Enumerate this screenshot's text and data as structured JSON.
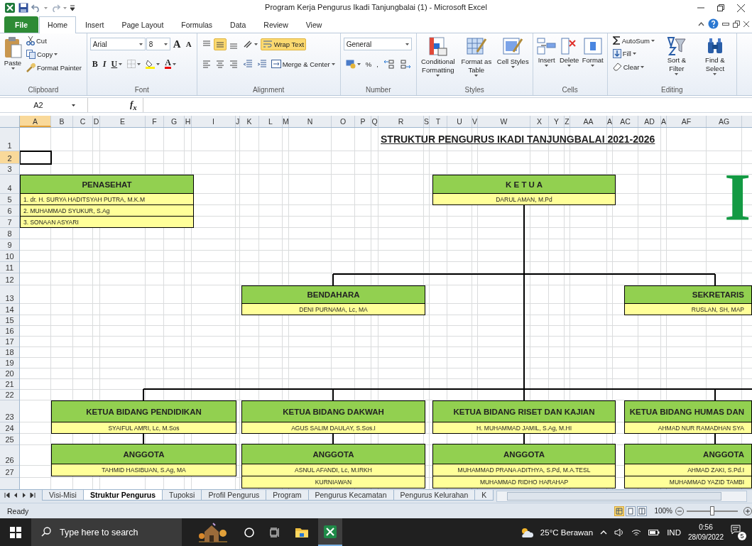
{
  "window": {
    "title": "Program Kerja Pengurus Ikadi Tanjungbalai (1)  -  Microsoft Excel"
  },
  "ribbon_tabs": [
    {
      "label": "File",
      "kind": "file",
      "selected": false
    },
    {
      "label": "Home",
      "kind": "tab",
      "selected": true
    },
    {
      "label": "Insert",
      "kind": "tab",
      "selected": false
    },
    {
      "label": "Page Layout",
      "kind": "tab",
      "selected": false
    },
    {
      "label": "Formulas",
      "kind": "tab",
      "selected": false
    },
    {
      "label": "Data",
      "kind": "tab",
      "selected": false
    },
    {
      "label": "Review",
      "kind": "tab",
      "selected": false
    },
    {
      "label": "View",
      "kind": "tab",
      "selected": false
    }
  ],
  "clipboard": {
    "paste": "Paste",
    "cut": "Cut",
    "copy": "Copy",
    "format_painter": "Format Painter",
    "label": "Clipboard"
  },
  "font": {
    "name": "Arial",
    "size": "8",
    "grow": "A",
    "shrink": "A",
    "bold": "B",
    "italic": "I",
    "underline": "U",
    "color_letter": "A",
    "label": "Font"
  },
  "alignment": {
    "vertical": [
      {
        "selected": false
      },
      {
        "selected": true
      },
      {
        "selected": false
      }
    ],
    "wrap_text": {
      "label": "Wrap Text",
      "selected": true
    },
    "merge": "Merge & Center",
    "label": "Alignment"
  },
  "number": {
    "format": "General",
    "percent": "%",
    "comma": ",",
    "label": "Number"
  },
  "styles": {
    "buttons": [
      "Conditional Formatting",
      "Format as Table",
      "Cell Styles"
    ],
    "label": "Styles"
  },
  "cells": {
    "buttons": [
      "Insert",
      "Delete",
      "Format"
    ],
    "label": "Cells"
  },
  "editing": {
    "autosum": "AutoSum",
    "fill": "Fill",
    "clear": "Clear",
    "sort": "Sort & Filter",
    "find": "Find & Select",
    "label": "Editing"
  },
  "formula_bar": {
    "name_box": "A2",
    "fx": "f$_{x}$"
  },
  "columns": [
    {
      "label": "A",
      "selected": true
    },
    {
      "label": "B",
      "selected": false
    },
    {
      "label": "C",
      "selected": false
    },
    {
      "label": "D",
      "selected": false
    },
    {
      "label": "E",
      "selected": false
    },
    {
      "label": "F",
      "selected": false
    },
    {
      "label": "G",
      "selected": false
    },
    {
      "label": "H",
      "selected": false
    },
    {
      "label": "I",
      "selected": false
    },
    {
      "label": "J",
      "selected": false
    },
    {
      "label": "K",
      "selected": false
    },
    {
      "label": "L",
      "selected": false
    },
    {
      "label": "M",
      "selected": false
    },
    {
      "label": "N",
      "selected": false
    },
    {
      "label": "O",
      "selected": false
    },
    {
      "label": "P",
      "selected": false
    },
    {
      "label": "Q",
      "selected": false
    },
    {
      "label": "R",
      "selected": false
    },
    {
      "label": "S",
      "selected": false
    },
    {
      "label": "T",
      "selected": false
    },
    {
      "label": "U",
      "selected": false
    },
    {
      "label": "V",
      "selected": false
    },
    {
      "label": "W",
      "selected": false
    },
    {
      "label": "X",
      "selected": false
    },
    {
      "label": "Y",
      "selected": false
    },
    {
      "label": "Z",
      "selected": false
    },
    {
      "label": "AA",
      "selected": false
    },
    {
      "label": "A",
      "selected": false
    },
    {
      "label": "AC",
      "selected": false
    },
    {
      "label": "AD",
      "selected": false
    },
    {
      "label": "A",
      "selected": false
    },
    {
      "label": "AF",
      "selected": false
    },
    {
      "label": "AG",
      "selected": false
    }
  ],
  "rows": [
    {
      "label": "1",
      "selected": false
    },
    {
      "label": "2",
      "selected": true
    },
    {
      "label": "3",
      "selected": false
    },
    {
      "label": "4",
      "selected": false
    },
    {
      "label": "5",
      "selected": false
    },
    {
      "label": "6",
      "selected": false
    },
    {
      "label": "7",
      "selected": false
    },
    {
      "label": "8",
      "selected": false
    },
    {
      "label": "9",
      "selected": false
    },
    {
      "label": "10",
      "selected": false
    },
    {
      "label": "11",
      "selected": false
    },
    {
      "label": "12",
      "selected": false
    },
    {
      "label": "13",
      "selected": false
    },
    {
      "label": "14",
      "selected": false
    },
    {
      "label": "15",
      "selected": false
    },
    {
      "label": "16",
      "selected": false
    },
    {
      "label": "17",
      "selected": false
    },
    {
      "label": "18",
      "selected": false
    },
    {
      "label": "19",
      "selected": false
    },
    {
      "label": "20",
      "selected": false
    },
    {
      "label": "21",
      "selected": false
    },
    {
      "label": "22",
      "selected": false
    },
    {
      "label": "23",
      "selected": false
    },
    {
      "label": "24",
      "selected": false
    },
    {
      "label": "25",
      "selected": false
    },
    {
      "label": "26",
      "selected": false
    },
    {
      "label": "27",
      "selected": false
    }
  ],
  "sheet_title": "STRUKTUR PENGURUS IKADI TANJUNGBALAI 2021-2026",
  "logo_text": "I",
  "org_chart": {
    "boxes": [
      {
        "title": "PENASEHAT",
        "members": [
          "1. dr. H. SURYA HADITSYAH PUTRA, M.K.M",
          "2. MUHAMMAD SYUKUR, S.Ag",
          "3. SONAAN ASYARI"
        ]
      },
      {
        "title": "K E T U A",
        "members": [
          "DARUL AMAN, M.Pd"
        ]
      },
      {
        "title": "BENDAHARA",
        "members": [
          "DENI PURNAMA, Lc, MA"
        ]
      },
      {
        "title": "SEKRETARIS",
        "members": [
          "RUSLAN, SH, MAP"
        ]
      },
      {
        "title": "KETUA BIDANG PENDIDIKAN",
        "members": [
          "SYAIFUL AMRI, Lc, M.Sos"
        ]
      },
      {
        "title": "KETUA BIDANG DAKWAH",
        "members": [
          "AGUS SALIM DAULAY, S.Sos.I"
        ]
      },
      {
        "title": "KETUA BIDANG RISET DAN KAJIAN",
        "members": [
          "H. MUHAMMAD JAMIL, S.Ag, M.HI"
        ]
      },
      {
        "title": "KETUA BIDANG HUMAS DAN",
        "members": [
          "AHMAD NUR RAMADHAN SYA"
        ]
      },
      {
        "title": "ANGGOTA",
        "members": [
          "TAHMID HASIBUAN, S.Ag, MA"
        ]
      },
      {
        "title": "ANGGOTA",
        "members": [
          "ASNUL AFANDI, Lc, M.IRKH",
          "KURNIAWAN"
        ]
      },
      {
        "title": "ANGGOTA",
        "members": [
          "MUHAMMAD PRANA ADITHYA, S.Pd, M.A.TESL",
          "MUHAMMAD RIDHO HARAHAP"
        ]
      },
      {
        "title": "ANGGOTA",
        "members": [
          "AHMAD ZAKI, S.Pd.I",
          "MUHAMMAD YAZID TAMBI"
        ]
      }
    ]
  },
  "sheet_tabs": [
    {
      "label": "Visi-Misi",
      "selected": false
    },
    {
      "label": "Struktur Pengurus",
      "selected": true
    },
    {
      "label": "Tupoksi",
      "selected": false
    },
    {
      "label": "Profil Pengurus",
      "selected": false
    },
    {
      "label": "Program",
      "selected": false
    },
    {
      "label": "Pengurus Kecamatan",
      "selected": false
    },
    {
      "label": "Pengurus Kelurahan",
      "selected": false
    },
    {
      "label": "K",
      "selected": false
    }
  ],
  "status_bar": {
    "text": "Ready",
    "views": [
      {
        "selected": true
      },
      {
        "selected": false
      },
      {
        "selected": false
      }
    ],
    "zoom": "100%",
    "zoom_slider": {
      "level": 0.5
    }
  },
  "taskbar": {
    "search": {
      "placeholder": "Type here to search"
    },
    "weather": "25°C  Berawan",
    "language": "IND",
    "time": "0:56",
    "date": "28/09/2022",
    "notifications": "5"
  }
}
